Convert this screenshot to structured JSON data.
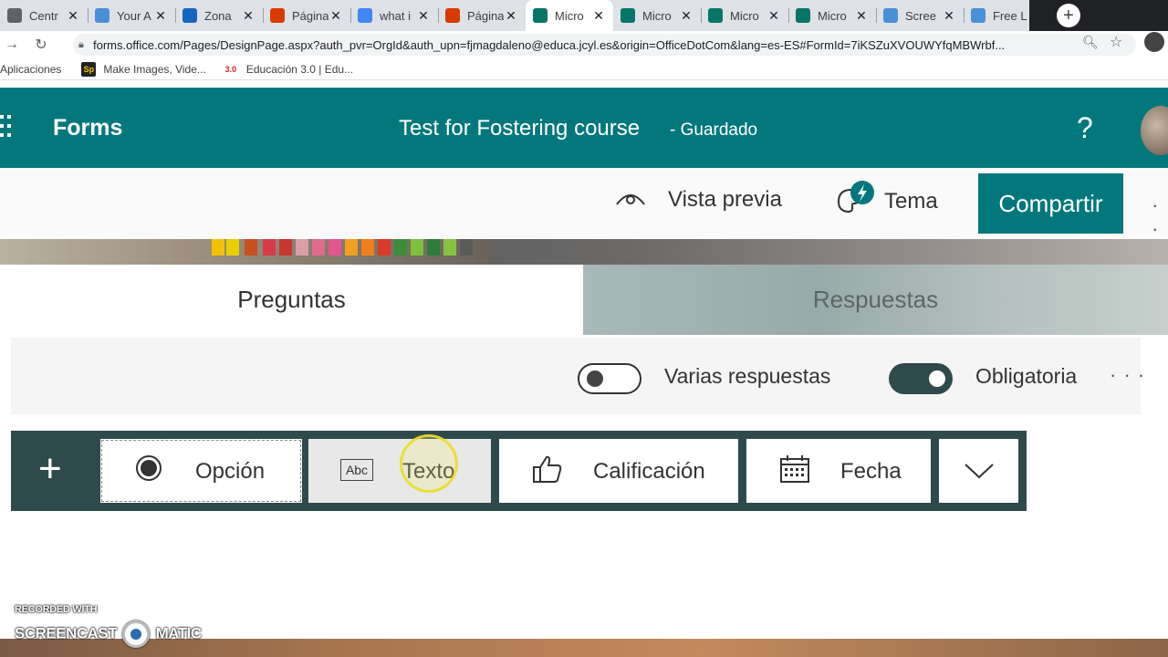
{
  "browser": {
    "tabs": [
      {
        "title": "Centr",
        "icon": "page-icon",
        "color": "#5f6368",
        "active": false
      },
      {
        "title": "Your A",
        "icon": "circle-icon",
        "color": "#4a90d9",
        "active": false
      },
      {
        "title": "Zona",
        "icon": "zona-logo-icon",
        "color": "#1565c0",
        "active": false
      },
      {
        "title": "Página",
        "icon": "office-icon",
        "color": "#d83b01",
        "active": false
      },
      {
        "title": "what i",
        "icon": "google-icon",
        "color": "#4285f4",
        "active": false
      },
      {
        "title": "Página",
        "icon": "office-icon",
        "color": "#d83b01",
        "active": false
      },
      {
        "title": "Micro",
        "icon": "forms-icon",
        "color": "#077568",
        "active": true
      },
      {
        "title": "Micro",
        "icon": "forms-icon",
        "color": "#077568",
        "active": false
      },
      {
        "title": "Micro",
        "icon": "forms-icon",
        "color": "#077568",
        "active": false
      },
      {
        "title": "Micro",
        "icon": "forms-icon",
        "color": "#077568",
        "active": false
      },
      {
        "title": "Scree",
        "icon": "circle-icon",
        "color": "#4a90d9",
        "active": false
      },
      {
        "title": "Free L",
        "icon": "circle-icon",
        "color": "#4a90d9",
        "active": false
      }
    ],
    "close_glyph": "✕",
    "new_tab_glyph": "+",
    "url": "forms.office.com/Pages/DesignPage.aspx?auth_pvr=OrgId&auth_upn=fjmagdaleno@educa.jcyl.es&origin=OfficeDotCom&lang=es-ES#FormId=7iKSZuXVOUWYfqMBWrbf...",
    "bookmarks": [
      {
        "label": "Aplicaciones",
        "icon": "apps-icon"
      },
      {
        "label": "Make Images, Vide...",
        "icon": "sp-icon",
        "icon_text": "Sp"
      },
      {
        "label": "Educación 3.0 | Edu...",
        "icon": "edu-icon",
        "icon_text": "3.0"
      }
    ]
  },
  "forms": {
    "app_name": "Forms",
    "title": "Test for Fostering course",
    "status": "- Guardado",
    "help": "?",
    "brand_color": "#03787c"
  },
  "commandbar": {
    "preview": "Vista previa",
    "theme": "Tema",
    "share": "Compartir",
    "more": "· ·"
  },
  "tabs": {
    "questions": "Preguntas",
    "responses": "Respuestas"
  },
  "question_options": {
    "multiple_answers": {
      "label": "Varias respuestas",
      "on": false
    },
    "required": {
      "label": "Obligatoria",
      "on": true
    },
    "more": "· · ·"
  },
  "insert_bar": {
    "add": "+",
    "types": [
      {
        "label": "Opción",
        "icon": "radio-icon"
      },
      {
        "label": "Texto",
        "icon": "abc-text-icon",
        "icon_text": "Abc"
      },
      {
        "label": "Calificación",
        "icon": "thumbs-up-icon"
      },
      {
        "label": "Fecha",
        "icon": "calendar-icon"
      }
    ],
    "expand": "chevron-down-icon"
  },
  "watermark": {
    "line1": "RECORDED WITH",
    "left": "SCREENCAST",
    "right": "MATIC"
  }
}
